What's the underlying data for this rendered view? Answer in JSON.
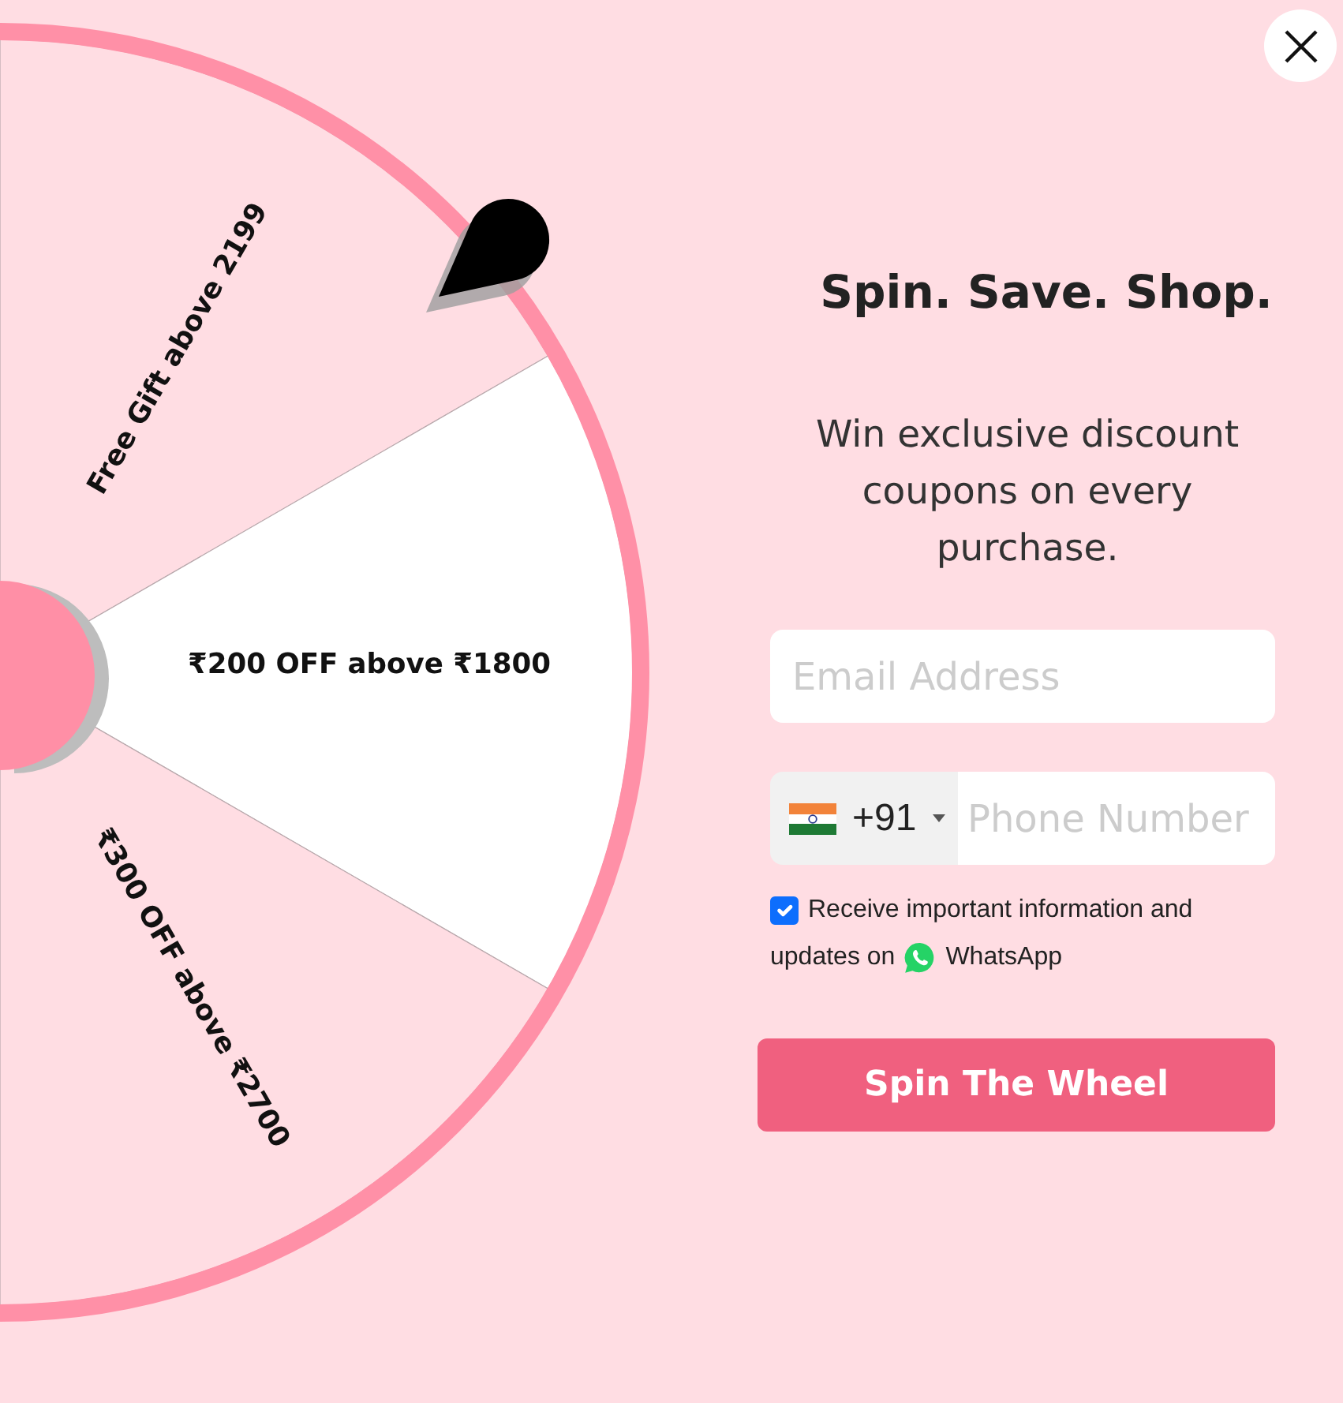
{
  "wheel": {
    "segments": [
      {
        "label": "Free Gift above 2199",
        "color": "#ffdde3"
      },
      {
        "label": "₹200 OFF above ₹1800",
        "color": "#ffffff"
      },
      {
        "label": "₹300 OFF above ₹2700",
        "color": "#ffdde3"
      }
    ]
  },
  "title": "Spin. Save. Shop.",
  "subtitle": "Win exclusive discount coupons on every purchase.",
  "email_field": {
    "placeholder": "Email Address"
  },
  "phone_field": {
    "country_code": "+91",
    "placeholder": "Phone Number"
  },
  "consent": {
    "checked": true,
    "label_lines": [
      "Receive important information and",
      "updates on"
    ],
    "app_name": "WhatsApp"
  },
  "submit_button": {
    "label": "Spin The Wheel"
  }
}
